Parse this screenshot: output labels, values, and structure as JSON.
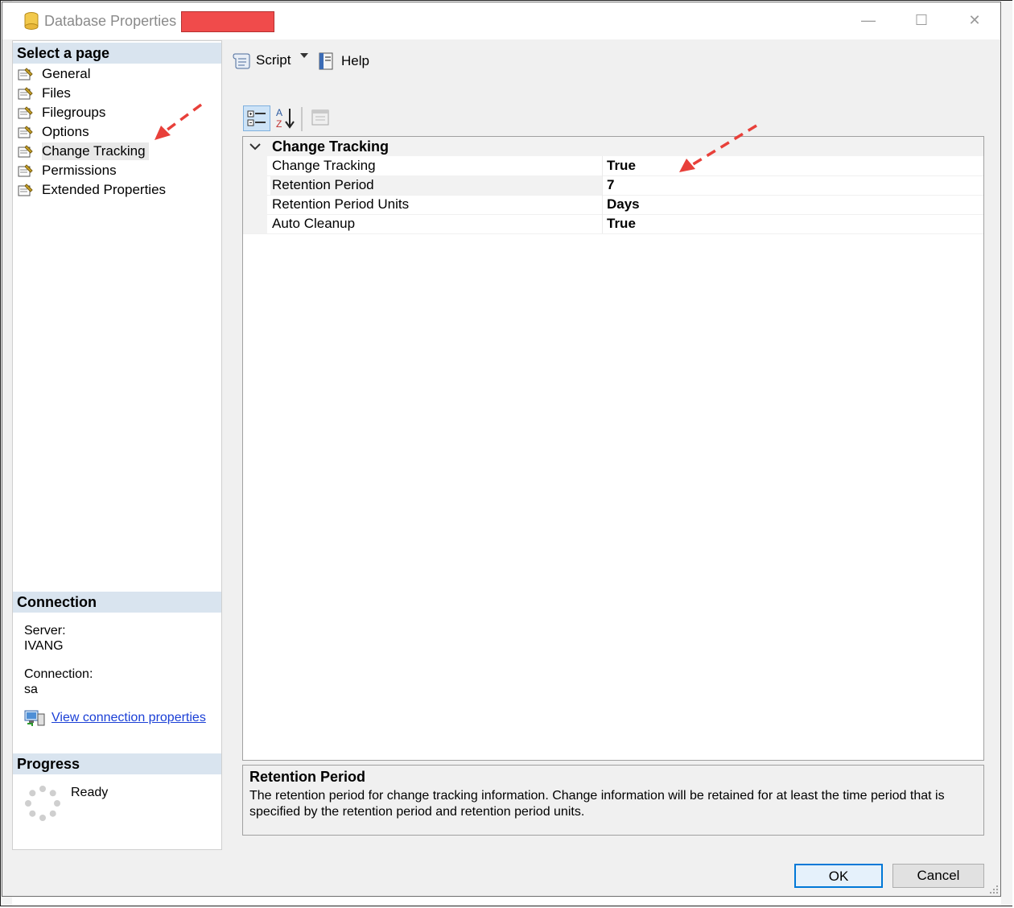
{
  "window": {
    "title": "Database Properties -"
  },
  "left_pane": {
    "select_page_header": "Select a page",
    "pages": [
      {
        "label": "General"
      },
      {
        "label": "Files"
      },
      {
        "label": "Filegroups"
      },
      {
        "label": "Options"
      },
      {
        "label": "Change Tracking",
        "selected": true
      },
      {
        "label": "Permissions"
      },
      {
        "label": "Extended Properties"
      }
    ],
    "connection_header": "Connection",
    "server_label": "Server:",
    "server_value": "IVANG",
    "connection_label": "Connection:",
    "connection_value": "sa",
    "view_connection_link": "View connection properties",
    "progress_header": "Progress",
    "progress_status": "Ready"
  },
  "toolbar": {
    "script_label": "Script",
    "help_label": "Help"
  },
  "property_grid": {
    "category": "Change Tracking",
    "rows": [
      {
        "name": "Change Tracking",
        "value": "True"
      },
      {
        "name": "Retention Period",
        "value": "7"
      },
      {
        "name": "Retention Period Units",
        "value": "Days"
      },
      {
        "name": "Auto Cleanup",
        "value": "True"
      }
    ]
  },
  "description": {
    "title": "Retention Period",
    "text": "The retention period for change tracking information. Change information will be retained for at least the time period that is specified by the retention period and retention period units."
  },
  "buttons": {
    "ok": "OK",
    "cancel": "Cancel"
  },
  "colors": {
    "section_header_bg": "#d9e4ef",
    "redaction": "#f04b4b",
    "annotation_arrow": "#e8403a",
    "link": "#1a3fd6",
    "ok_border": "#0078d7"
  }
}
